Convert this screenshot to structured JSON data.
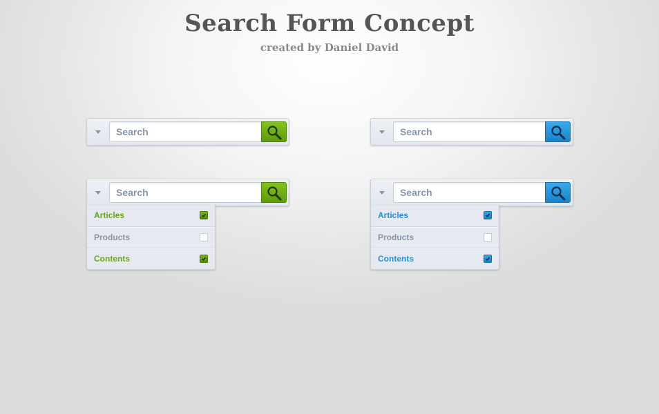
{
  "header": {
    "title": "Search Form Concept",
    "subtitle": "created by Daniel David"
  },
  "theme_colors": {
    "green_accent": "#6aa80f",
    "blue_accent": "#2590d9",
    "inactive_text": "#8594a6"
  },
  "widgets": [
    {
      "id": "green-collapsed",
      "theme": "green",
      "search": {
        "placeholder": "Search",
        "value": ""
      },
      "dropdown_open": false
    },
    {
      "id": "blue-collapsed",
      "theme": "blue",
      "search": {
        "placeholder": "Search",
        "value": ""
      },
      "dropdown_open": false
    },
    {
      "id": "green-expanded",
      "theme": "green",
      "search": {
        "placeholder": "Search",
        "value": ""
      },
      "dropdown_open": true,
      "options": [
        {
          "label": "Articles",
          "checked": true
        },
        {
          "label": "Products",
          "checked": false
        },
        {
          "label": "Contents",
          "checked": true
        }
      ]
    },
    {
      "id": "blue-expanded",
      "theme": "blue",
      "search": {
        "placeholder": "Search",
        "value": ""
      },
      "dropdown_open": true,
      "options": [
        {
          "label": "Articles",
          "checked": true
        },
        {
          "label": "Products",
          "checked": false
        },
        {
          "label": "Contents",
          "checked": true
        }
      ]
    }
  ],
  "icons": {
    "toggle": "chevron-down-icon",
    "search_button": "magnifier-icon",
    "checkbox_checked": "checkmark-icon"
  }
}
